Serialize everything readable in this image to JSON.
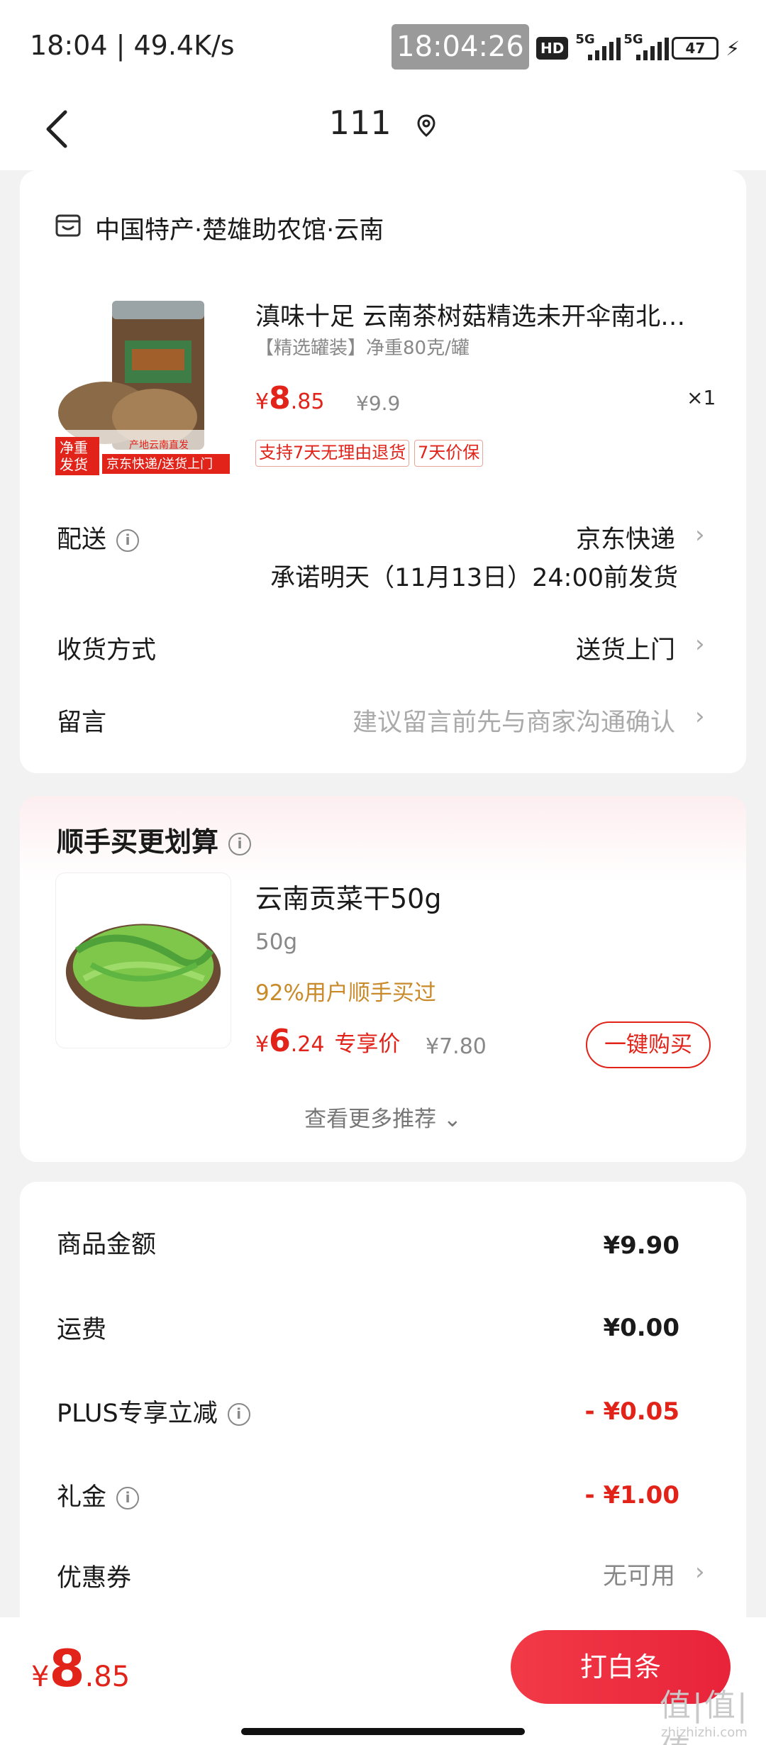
{
  "status_bar": {
    "time": "18:04 | 49.4K/s",
    "clock_badge": "18:04:26",
    "hd": "HD",
    "net1": "5G",
    "net2": "5G",
    "battery": "47"
  },
  "nav": {
    "title": "111",
    "back_icon": "chevron-left-icon",
    "location_icon": "location-pin-icon"
  },
  "shop": {
    "name": "中国特产·楚雄助农馆·云南"
  },
  "product": {
    "title": "滇味十足 云南茶树菇精选未开伞南北干货",
    "spec": "【精选罐装】净重80克/罐",
    "price_symbol": "¥",
    "price_int": "8",
    "price_dec": ".85",
    "original_price": "¥9.9",
    "quantity": "×1",
    "tags": [
      "支持7天无理由退货",
      "7天价保"
    ],
    "image_badges": [
      "净重",
      "发货",
      "产地云南直发",
      "京东快递/送货上门"
    ]
  },
  "shipping": {
    "label": "配送",
    "value": "京东快递",
    "promise": "承诺明天（11月13日）24:00前发货"
  },
  "receive": {
    "label": "收货方式",
    "value": "送货上门"
  },
  "message": {
    "label": "留言",
    "placeholder": "建议留言前先与商家沟通确认"
  },
  "upsell": {
    "title": "顺手买更划算",
    "name": "云南贡菜干50g",
    "spec": "50g",
    "percent": "92%用户顺手买过",
    "price_symbol": "¥",
    "price_int": "6",
    "price_dec": ".24",
    "price_label": "专享价",
    "original_price": "¥7.80",
    "buy_label": "一键购买",
    "more_label": "查看更多推荐 ⌄"
  },
  "summary": {
    "rows": [
      {
        "label": "商品金额",
        "value": "¥9.90"
      },
      {
        "label": "运费",
        "value": "¥0.00"
      },
      {
        "label": "PLUS专享立减",
        "value": "- ¥0.05"
      },
      {
        "label": "礼金",
        "value": "- ¥1.00"
      },
      {
        "label": "优惠券",
        "value": "无可用"
      }
    ]
  },
  "footer": {
    "total_symbol": "¥",
    "total_int": "8",
    "total_dec": ".85",
    "pay_label": "打白条",
    "watermark": "值|值|值",
    "watermark_url": "zhizhizhi.com"
  },
  "colors": {
    "accent_red": "#e2231a",
    "gold": "#c98a2a"
  }
}
